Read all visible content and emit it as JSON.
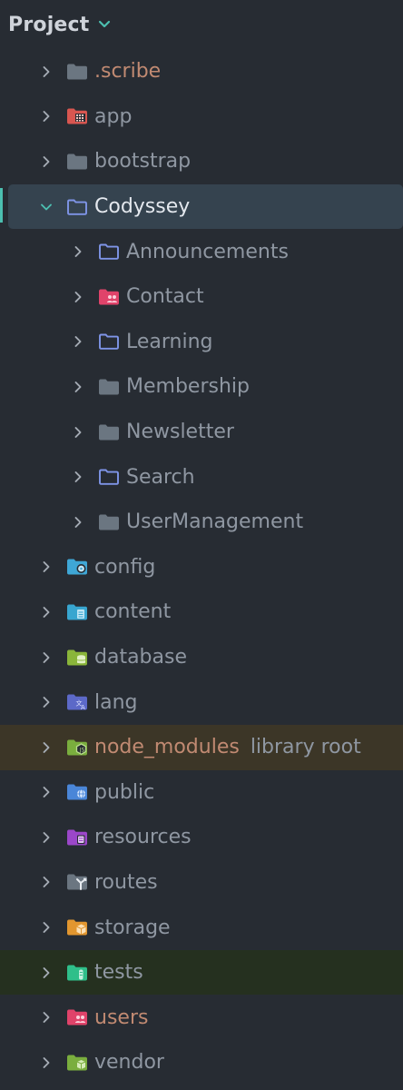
{
  "panel": {
    "title": "Project"
  },
  "tree": {
    "items": [
      {
        "label": ".scribe",
        "icon": "folder-icon",
        "color": "orange"
      },
      {
        "label": "app",
        "icon": "folder-app-icon",
        "color": "normal"
      },
      {
        "label": "bootstrap",
        "icon": "folder-icon",
        "color": "normal"
      },
      {
        "label": "Codyssey",
        "icon": "folder-outline-icon",
        "color": "bright",
        "expanded": true,
        "selected": true
      },
      {
        "label": "Announcements",
        "icon": "folder-outline-icon",
        "color": "normal",
        "child": true
      },
      {
        "label": "Contact",
        "icon": "folder-users-icon",
        "color": "normal",
        "child": true
      },
      {
        "label": "Learning",
        "icon": "folder-outline-icon",
        "color": "normal",
        "child": true
      },
      {
        "label": "Membership",
        "icon": "folder-icon",
        "color": "normal",
        "child": true
      },
      {
        "label": "Newsletter",
        "icon": "folder-icon",
        "color": "normal",
        "child": true
      },
      {
        "label": "Search",
        "icon": "folder-outline-icon",
        "color": "normal",
        "child": true
      },
      {
        "label": "UserManagement",
        "icon": "folder-icon",
        "color": "normal",
        "child": true
      },
      {
        "label": "config",
        "icon": "folder-config-icon",
        "color": "normal"
      },
      {
        "label": "content",
        "icon": "folder-content-icon",
        "color": "normal"
      },
      {
        "label": "database",
        "icon": "folder-database-icon",
        "color": "normal"
      },
      {
        "label": "lang",
        "icon": "folder-lang-icon",
        "color": "normal"
      },
      {
        "label": "node_modules",
        "hint": "library root",
        "icon": "folder-node-icon",
        "color": "orange",
        "library": true
      },
      {
        "label": "public",
        "icon": "folder-public-icon",
        "color": "normal"
      },
      {
        "label": "resources",
        "icon": "folder-resources-icon",
        "color": "normal"
      },
      {
        "label": "routes",
        "icon": "folder-routes-icon",
        "color": "normal"
      },
      {
        "label": "storage",
        "icon": "folder-storage-icon",
        "color": "normal"
      },
      {
        "label": "tests",
        "icon": "folder-tests-icon",
        "color": "normal",
        "tests": true
      },
      {
        "label": "users",
        "icon": "folder-users-icon",
        "color": "orange"
      },
      {
        "label": "vendor",
        "icon": "folder-vendor-icon",
        "color": "normal"
      }
    ]
  },
  "colors": {
    "background": "#272c33",
    "selection": "#35434f",
    "library_row": "#3c3627",
    "tests_row": "#25301f",
    "accent": "#4cbfb0"
  }
}
